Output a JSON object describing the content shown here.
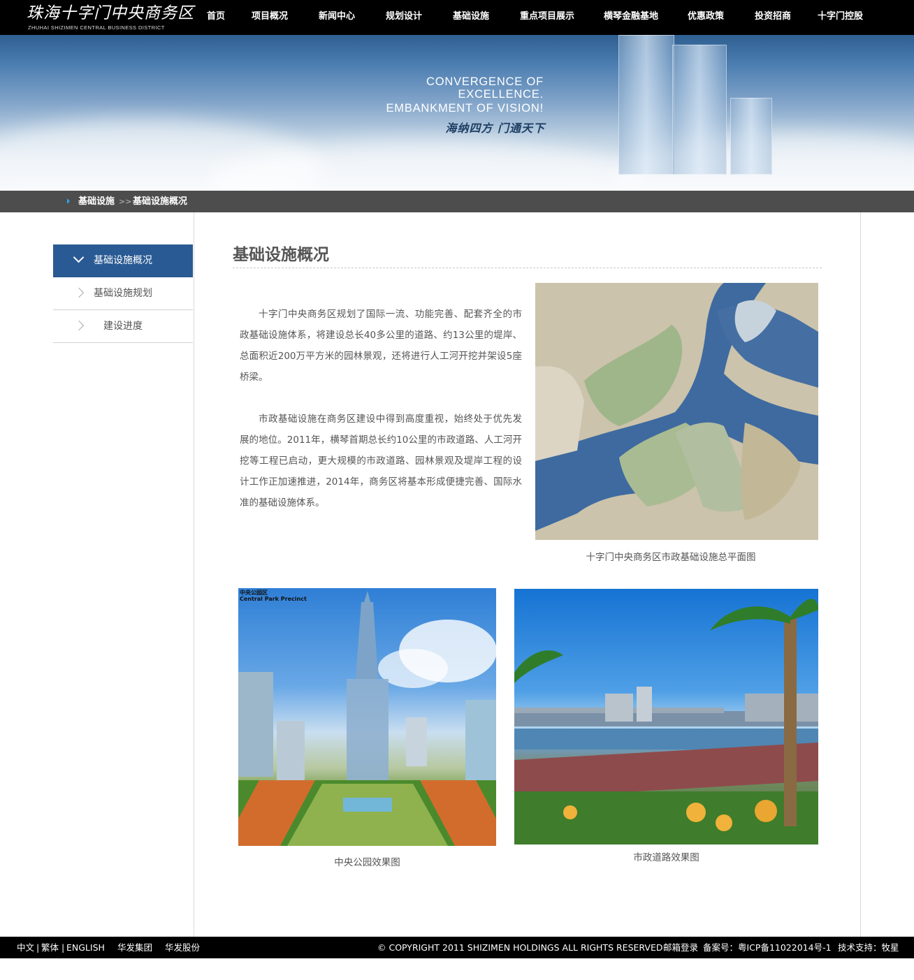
{
  "header": {
    "logo_cn": "珠海十字门中央商务区",
    "logo_en": "ZHUHAI SHIZIMEN CENTRAL BUSINESS DISTRICT",
    "nav": [
      "首页",
      "项目概况",
      "新闻中心",
      "规划设计",
      "基础设施",
      "重点项目展示",
      "横琴金融基地",
      "优惠政策",
      "投资招商",
      "十字门控股"
    ]
  },
  "banner": {
    "lines": [
      "CONVERGENCE OF",
      "EXCELLENCE.",
      "EMBANKMENT OF VISION!"
    ],
    "slogan": "海纳四方 门通天下"
  },
  "breadcrumb": {
    "section": "基础设施",
    "separator": ">>",
    "current": "基础设施概况"
  },
  "sidebar": {
    "items": [
      "基础设施概况",
      "基础设施规划",
      "建设进度"
    ],
    "active_index": 0
  },
  "content": {
    "title": "基础设施概况",
    "paragraphs": [
      "十字门中央商务区规划了国际一流、功能完善、配套齐全的市政基础设施体系，将建设总长40多公里的道路、约13公里的堤岸、总面积近200万平方米的园林景观，还将进行人工河开挖并架设5座桥梁。",
      "市政基础设施在商务区建设中得到高度重视，始终处于优先发展的地位。2011年，横琴首期总长约10公里的市政道路、人工河开挖等工程已启动，更大规模的市政道路、园林景观及堤岸工程的设计工作正加速推进，2014年，商务区将基本形成便捷完善、国际水准的基础设施体系。"
    ],
    "map_caption": "十字门中央商务区市政基础设施总平面图",
    "park_label_cn": "中央公园区",
    "park_label_en": "Central Park Precinct",
    "park_caption": "中央公园效果图",
    "road_caption": "市政道路效果图"
  },
  "footer": {
    "lang_cn": "中文",
    "lang_tw": "繁体",
    "lang_en": "ENGLISH",
    "divider": "|",
    "link_group": "华发集团",
    "link_shares": "华发股份",
    "copyright": "© COPYRIGHT 2011 SHIZIMEN HOLDINGS ALL RIGHTS RESERVED",
    "mail_login": "邮箱登录",
    "icp": "备案号：粤ICP备11022014号-1",
    "tech_support": "技术支持：牧星"
  },
  "colors": {
    "topbar": "#000000",
    "crumbbar": "#4d4d4d",
    "sidebar_active": "#295a93",
    "crumb_arrow": "#2ea7e0"
  }
}
